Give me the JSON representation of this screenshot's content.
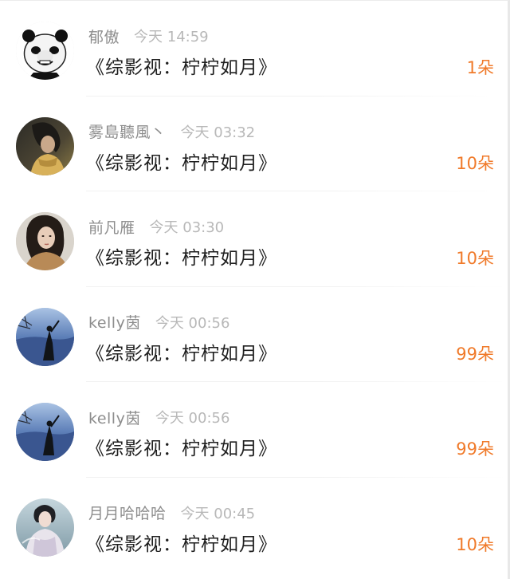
{
  "gift_list": {
    "items": [
      {
        "user": "郁傲",
        "time": "今天 14:59",
        "title": "《综影视：柠柠如月》",
        "gift": "1朵",
        "avatar": "panda-meme-avatar"
      },
      {
        "user": "雾島聽風丶",
        "time": "今天 03:32",
        "title": "《综影视：柠柠如月》",
        "gift": "10朵",
        "avatar": "girl-photo-avatar"
      },
      {
        "user": "前凡雁",
        "time": "今天 03:30",
        "title": "《综影视：柠柠如月》",
        "gift": "10朵",
        "avatar": "woman-portrait-avatar"
      },
      {
        "user": "kelly茵",
        "time": "今天 00:56",
        "title": "《综影视：柠柠如月》",
        "gift": "99朵",
        "avatar": "lakeside-silhouette-avatar"
      },
      {
        "user": "kelly茵",
        "time": "今天 00:56",
        "title": "《综影视：柠柠如月》",
        "gift": "99朵",
        "avatar": "lakeside-silhouette-avatar"
      },
      {
        "user": "月月哈哈哈",
        "time": "今天 00:45",
        "title": "《综影视：柠柠如月》",
        "gift": "10朵",
        "avatar": "hanfu-woman-avatar"
      }
    ]
  },
  "colors": {
    "username": "#8d8d8d",
    "time": "#b8b8b8",
    "title": "#1f1f1f",
    "gift": "#f07a2a",
    "divider": "#f1f1f1"
  }
}
